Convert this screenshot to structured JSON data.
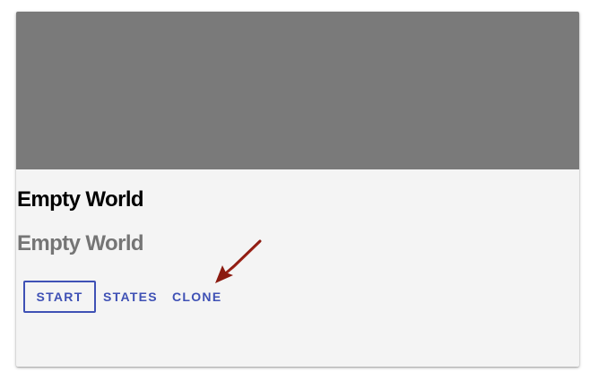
{
  "card": {
    "title": "Empty World",
    "subtitle": "Empty World",
    "actions": {
      "start_label": "START",
      "states_label": "STATES",
      "clone_label": "CLONE"
    }
  },
  "colors": {
    "media_placeholder": "#7a7a7a",
    "card_background": "#f4f4f4",
    "accent": "#3f51b5",
    "subtitle": "#757575",
    "annotation_arrow": "#8b1a10"
  },
  "annotation": {
    "icon": "red-arrow-icon",
    "points_to": "clone-button"
  }
}
